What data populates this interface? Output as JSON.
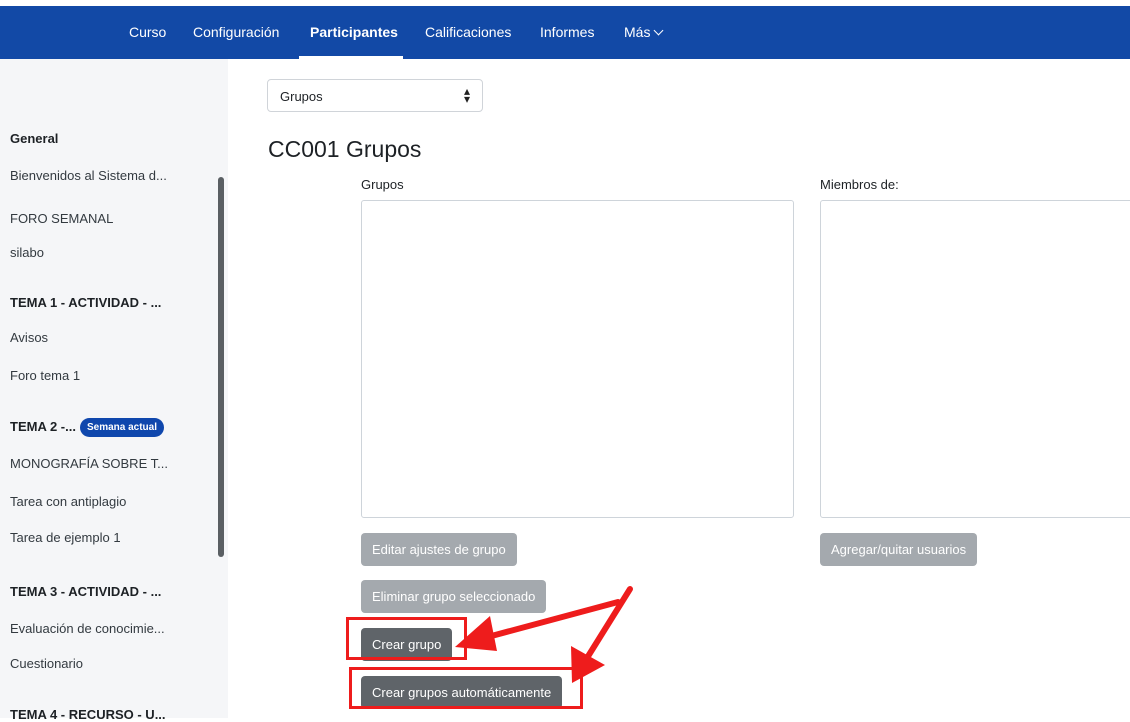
{
  "nav": {
    "items": [
      "Curso",
      "Configuración",
      "Participantes",
      "Calificaciones",
      "Informes",
      "Más"
    ],
    "active": "Participantes"
  },
  "sidebar": {
    "items": [
      {
        "label": "General",
        "section": true
      },
      {
        "label": "Bienvenidos al Sistema d...",
        "section": false
      },
      {
        "label": "FORO SEMANAL",
        "section": false
      },
      {
        "label": "silabo",
        "section": false
      },
      {
        "label": "TEMA 1 - ACTIVIDAD - ...",
        "section": true
      },
      {
        "label": "Avisos",
        "section": false
      },
      {
        "label": "Foro tema 1",
        "section": false
      },
      {
        "label": "TEMA 2 -...",
        "section": true,
        "badge": "Semana actual"
      },
      {
        "label": "MONOGRAFÍA SOBRE T...",
        "section": false
      },
      {
        "label": "Tarea con antiplagio",
        "section": false
      },
      {
        "label": "Tarea de ejemplo 1",
        "section": false
      },
      {
        "label": "TEMA 3 - ACTIVIDAD - ...",
        "section": true
      },
      {
        "label": "Evaluación de conocimie...",
        "section": false
      },
      {
        "label": "Cuestionario",
        "section": false
      },
      {
        "label": "TEMA 4 - RECURSO - U...",
        "section": true
      }
    ]
  },
  "main": {
    "select_value": "Grupos",
    "title": "CC001 Grupos",
    "groups_label": "Grupos",
    "members_label": "Miembros de:",
    "buttons": {
      "edit": "Editar ajustes de grupo",
      "add_remove": "Agregar/quitar usuarios",
      "delete": "Eliminar grupo seleccionado",
      "create": "Crear grupo",
      "auto_create": "Crear grupos automáticamente"
    }
  },
  "colors": {
    "nav_bg": "#1249a6",
    "badge_bg": "#0f47ad",
    "annotation_red": "#ee1c1c"
  }
}
